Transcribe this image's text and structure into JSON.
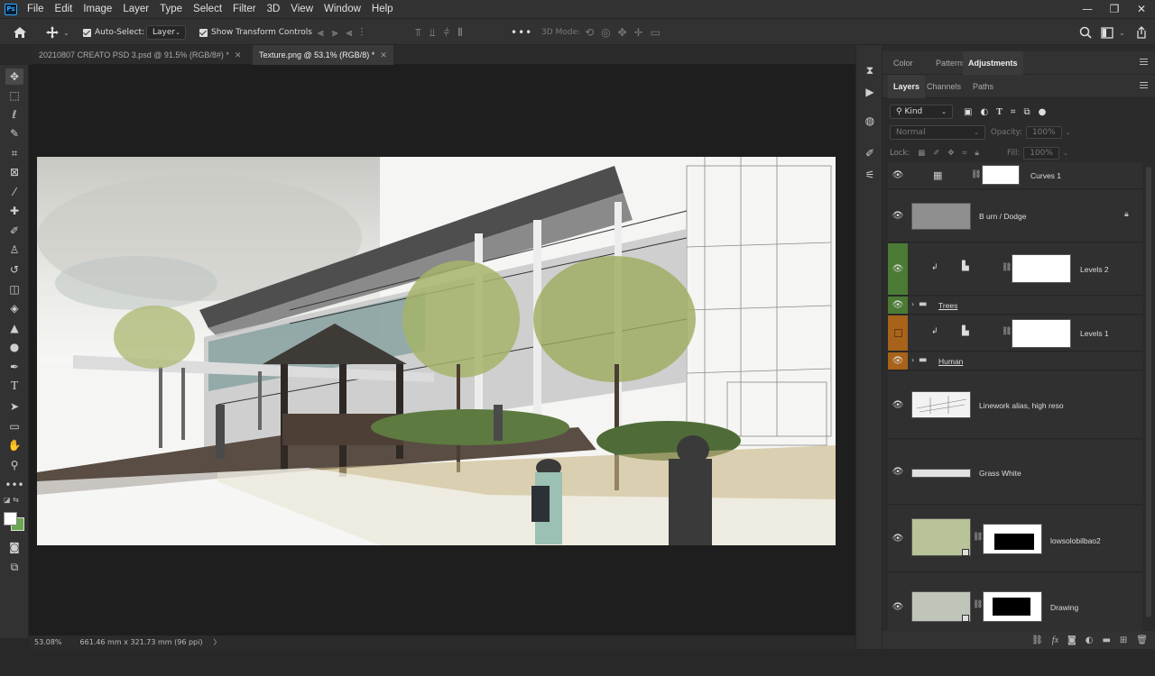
{
  "menu": {
    "logo": "Ps",
    "items": [
      "File",
      "Edit",
      "Image",
      "Layer",
      "Type",
      "Select",
      "Filter",
      "3D",
      "View",
      "Window",
      "Help"
    ]
  },
  "window_controls": {
    "minimize": "—",
    "maximize": "❐",
    "close": "✕"
  },
  "options": {
    "auto_select_label": "Auto-Select:",
    "auto_select_target": "Layer",
    "transform_label": "Show Transform Controls",
    "mode_3d_label": "3D Mode:",
    "more": "•••"
  },
  "tabs": [
    {
      "label": "20210807 CREATO PSD 3.psd @ 91.5% (RGB/8#) *",
      "close": "✕"
    },
    {
      "label": "Texture.png @ 53.1% (RGB/8) *",
      "close": "✕"
    }
  ],
  "status": {
    "zoom": "53.08%",
    "dimensions": "661.46 mm x 321.73 mm (96 ppi)",
    "arrow": "〉"
  },
  "panel_top": {
    "tabs": [
      "Color",
      "Patterns",
      "Adjustments"
    ],
    "active": "Adjustments"
  },
  "panel_layers": {
    "tabs": [
      "Layers",
      "Channels",
      "Paths"
    ],
    "active": "Layers",
    "filter_kind": "Kind",
    "blend_mode": "Normal",
    "opacity_label": "Opacity:",
    "opacity_value": "100%",
    "lock_label": "Lock:",
    "fill_label": "Fill:",
    "fill_value": "100%"
  },
  "layers": [
    {
      "name": "Curves 1"
    },
    {
      "name": "B urn / Dodge"
    },
    {
      "name": "Levels 2"
    },
    {
      "name": "Trees"
    },
    {
      "name": "Levels 1"
    },
    {
      "name": "Human"
    },
    {
      "name": "Linework alias, high reso"
    },
    {
      "name": "Grass White"
    },
    {
      "name": "lowsolobilbao2"
    },
    {
      "name": "Drawing"
    }
  ],
  "colors": {
    "green_tag": "#4a7a34",
    "orange_tag": "#a8621a",
    "bg_color_swatch": "#6aa84f"
  }
}
